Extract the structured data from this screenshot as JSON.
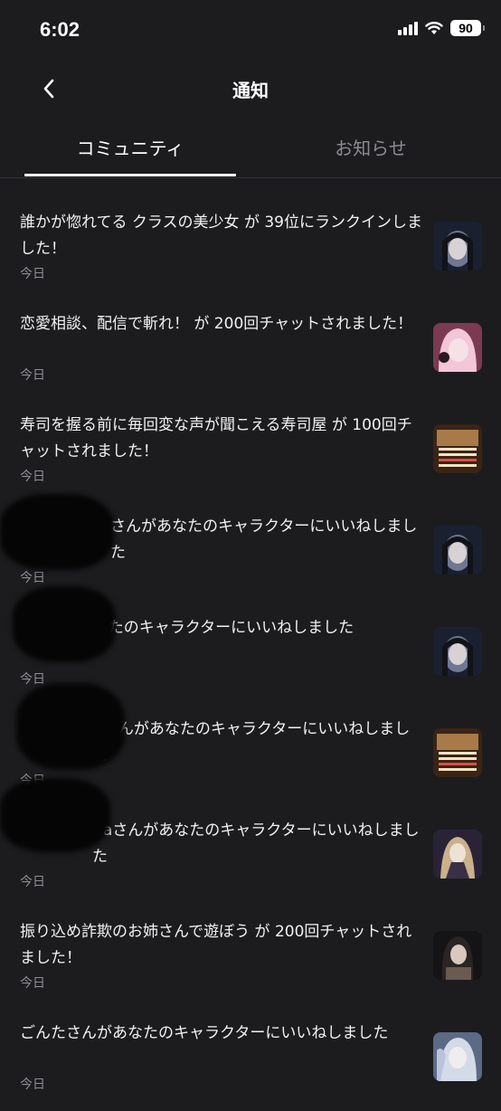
{
  "status_bar": {
    "time": "6:02",
    "battery": "90",
    "icons": [
      "cellular-signal-icon",
      "wifi-icon",
      "battery-icon"
    ]
  },
  "header": {
    "title": "通知",
    "back_icon": "chevron-left-icon"
  },
  "tabs": [
    {
      "label": "コミュニティ",
      "active": true
    },
    {
      "label": "お知らせ",
      "active": false
    }
  ],
  "notifications": [
    {
      "text": "誰かが惚れてる クラスの美少女 が 39位にランクインしました！",
      "date": "今日",
      "thumb_colors": [
        "#1b2030",
        "#6f7892"
      ]
    },
    {
      "text": "恋愛相談、配信で斬れ！ が 200回チャットされました！",
      "date": "今日",
      "thumb_colors": [
        "#7c3a52",
        "#f3c6d8"
      ]
    },
    {
      "text": "寿司を握る前に毎回変な声が聞こえる寿司屋 が 100回チャットされました！",
      "date": "今日",
      "thumb_colors": [
        "#3a2414",
        "#a87a48"
      ]
    },
    {
      "text": "さんがあなたのキャラクターにいいねしました",
      "date": "今日",
      "thumb_colors": [
        "#1b2030",
        "#6f7892"
      ]
    },
    {
      "text": "Hきんがあなたのキャラクターにいいねしました",
      "date": "今日",
      "thumb_colors": [
        "#1b2030",
        "#6f7892"
      ]
    },
    {
      "text": "Cさんがあなたのキャラクターにいいねしました",
      "date": "今日",
      "thumb_colors": [
        "#3a2414",
        "#a87a48"
      ]
    },
    {
      "text": "Caさんがあなたのキャラクターにいいねしました",
      "date": "今日",
      "thumb_colors": [
        "#2a2236",
        "#c9b18a"
      ]
    },
    {
      "text": "振り込め詐欺のお姉さんで遊ぼう が 200回チャットされました！",
      "date": "今日",
      "thumb_colors": [
        "#141416",
        "#6a5a50"
      ]
    },
    {
      "text": "ごんたさんがあなたのキャラクターにいいねしました",
      "date": "今日",
      "thumb_colors": [
        "#5c6a86",
        "#d4dbe8"
      ]
    }
  ]
}
